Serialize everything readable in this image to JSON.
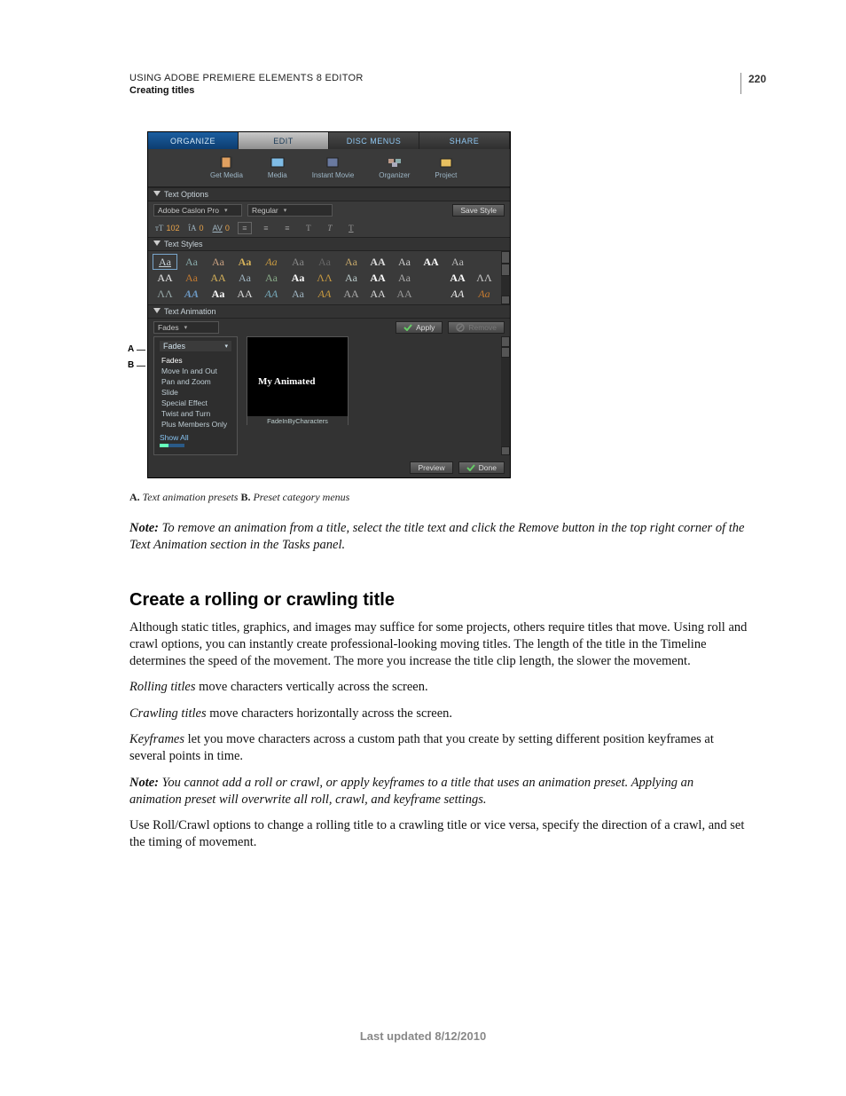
{
  "header": {
    "doc_title": "USING ADOBE PREMIERE ELEMENTS 8 EDITOR",
    "section": "Creating titles",
    "page_number": "220"
  },
  "shot": {
    "tabs": {
      "organize": "ORGANIZE",
      "edit": "EDIT",
      "disc": "DISC MENUS",
      "share": "SHARE"
    },
    "icons": {
      "get_media": "Get Media",
      "media": "Media",
      "instant_movie": "Instant Movie",
      "organizer": "Organizer",
      "project": "Project"
    },
    "text_options": {
      "label": "Text Options",
      "font": "Adobe Caslon Pro",
      "weight": "Regular",
      "save_style": "Save Style",
      "size_val": "102",
      "leading_val": "0",
      "kern_val": "0"
    },
    "text_styles": {
      "label": "Text Styles"
    },
    "text_animation": {
      "label": "Text Animation",
      "category_selected": "Fades",
      "apply": "Apply",
      "remove": "Remove",
      "categories": [
        "Fades",
        "Move In and Out",
        "Pan and Zoom",
        "Slide",
        "Special Effect",
        "Twist and Turn",
        "Plus Members Only"
      ],
      "show_all": "Show All",
      "preview_text": "My Animated",
      "preset_name": "FadeInByCharacters",
      "preview_btn": "Preview",
      "done_btn": "Done"
    }
  },
  "callouts": {
    "A": "A",
    "B": "B"
  },
  "caption": {
    "A_bold": "A.",
    "A_text": " Text animation presets  ",
    "B_bold": "B.",
    "B_text": " Preset category menus"
  },
  "note1_label": "Note: ",
  "note1_text": "To remove an animation from a title, select the title text and click the Remove button in the top right corner of the Text Animation section in the Tasks panel.",
  "section_title": "Create a rolling or crawling title",
  "p1": "Although static titles, graphics, and images may suffice for some projects, others require titles that move. Using roll and crawl options, you can instantly create professional-looking moving titles. The length of the title in the Timeline determines the speed of the movement. The more you increase the title clip length, the slower the movement.",
  "p2_it": "Rolling titles",
  "p2_rest": " move characters vertically across the screen.",
  "p3_it": "Crawling titles",
  "p3_rest": " move characters horizontally across the screen.",
  "p4_it": "Keyframes",
  "p4_rest": " let you move characters across a custom path that you create by setting different position keyframes at several points in time.",
  "note2_label": "Note: ",
  "note2_text": "You cannot add a roll or crawl, or apply keyframes to a title that uses an animation preset. Applying an animation preset will overwrite all roll, crawl, and keyframe settings.",
  "p5": "Use Roll/Crawl options to change a rolling title to a crawling title or vice versa, specify the direction of a crawl, and set the timing of movement.",
  "footer": "Last updated 8/12/2010"
}
